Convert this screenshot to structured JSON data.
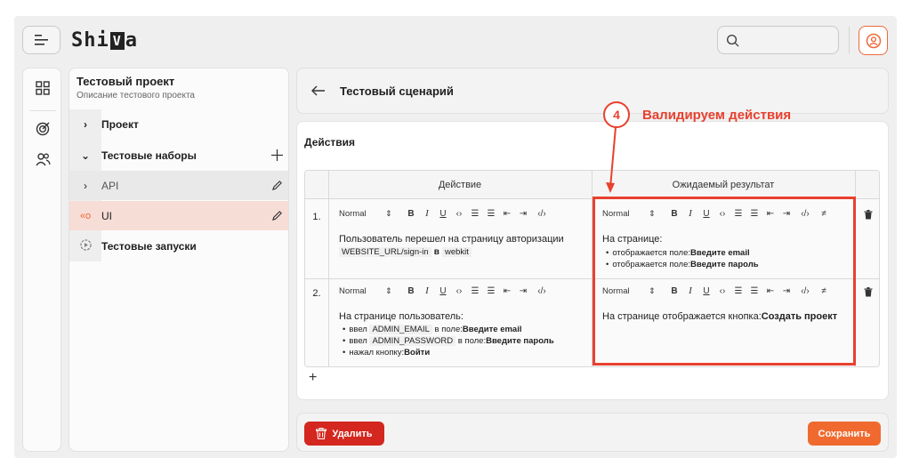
{
  "header": {
    "logo_text": "ShiVa",
    "logo_left": "Shi",
    "logo_box": "V",
    "logo_right": "a",
    "search_placeholder": ""
  },
  "sidebar_icons": [
    "grid-icon",
    "target-icon",
    "users-icon"
  ],
  "project": {
    "title": "Тестовый проект",
    "subtitle": "Описание тестового проекта",
    "items": [
      {
        "label": "Проект",
        "chevron": "›"
      },
      {
        "label": "Тестовые наборы",
        "chevron": "⌄"
      },
      {
        "label": "API",
        "chevron": "›"
      },
      {
        "label": "UI",
        "chevron": "«o"
      },
      {
        "label": "Тестовые запуски",
        "chevron": ""
      }
    ]
  },
  "scenario": {
    "title": "Тестовый сценарий",
    "section_title": "Действия",
    "columns": [
      "Действие",
      "Ожидаемый результат"
    ],
    "toolbar": {
      "style": "Normal",
      "bold": "B",
      "italic": "I",
      "underline": "U",
      "code": "‹›",
      "code_block": "‹/›"
    },
    "steps": [
      {
        "number": "1.",
        "action": {
          "text": "Пользователь перешел на страницу авторизации",
          "code1": "WEBSITE_URL/sign-in",
          "in": "в",
          "code2": "webkit"
        },
        "expected": {
          "intro": "На странице:",
          "bullets": [
            {
              "text": "отображается поле:",
              "bold": "Введите email"
            },
            {
              "text": "отображается поле:",
              "bold": "Введите пароль"
            }
          ]
        }
      },
      {
        "number": "2.",
        "action": {
          "intro": "На странице пользователь:",
          "bullets": [
            {
              "prefix": "ввел",
              "code": "ADMIN_EMAIL",
              "text": "в поле:",
              "bold": "Введите email"
            },
            {
              "prefix": "ввел",
              "code": "ADMIN_PASSWORD",
              "text": "в поле:",
              "bold": "Введите пароль"
            },
            {
              "prefix": "",
              "code": "",
              "text": "нажал кнопку:",
              "bold": "Войти"
            }
          ]
        },
        "expected": {
          "text": "На странице отображается кнопка:",
          "bold": "Создать проект"
        }
      }
    ],
    "add_label": "+"
  },
  "annotation": {
    "number": "4",
    "text": "Валидируем действия",
    "color": "#e8412f"
  },
  "footer": {
    "delete_label": "Удалить",
    "save_label": "Сохранить"
  },
  "colors": {
    "accent": "#f06a2f",
    "danger": "#d4271f",
    "selected_row": "#f6ddd5"
  }
}
